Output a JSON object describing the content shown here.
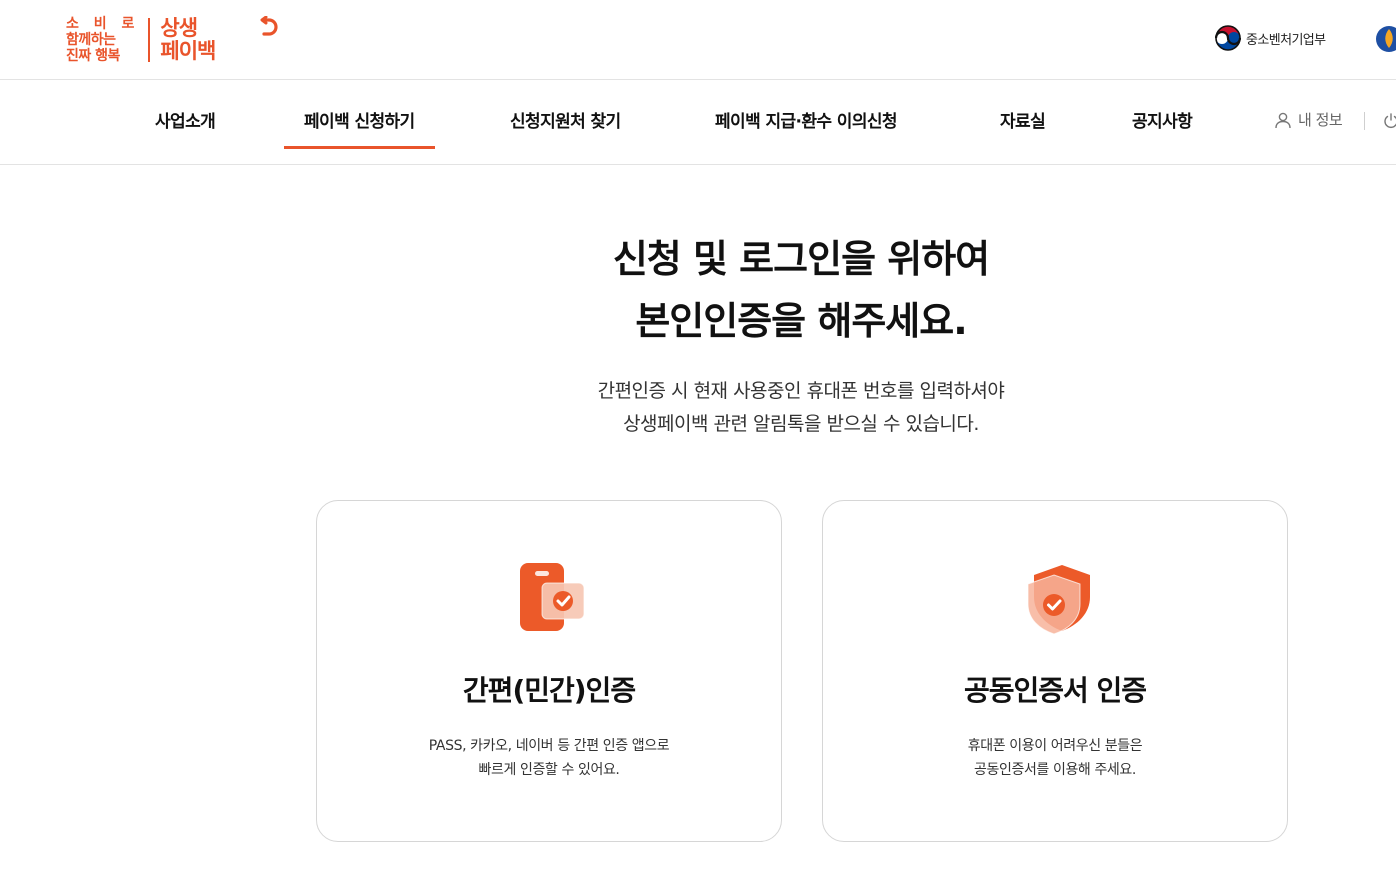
{
  "header": {
    "logo": {
      "slogan": [
        "소 비 로",
        "함께하는",
        "진짜 행복"
      ],
      "brand": [
        "상생",
        "페이백"
      ]
    },
    "ministry_label": "중소벤처기업부"
  },
  "nav": {
    "items": [
      {
        "label": "사업소개"
      },
      {
        "label": "페이백 신청하기",
        "active": true
      },
      {
        "label": "신청지원처 찾기"
      },
      {
        "label": "페이백 지급·환수 이의신청"
      },
      {
        "label": "자료실"
      },
      {
        "label": "공지사항"
      }
    ],
    "user_label": "내 정보"
  },
  "hero": {
    "title": [
      "신청 및 로그인을 위하여",
      "본인인증을 해주세요."
    ],
    "description": [
      "간편인증 시 현재 사용중인 휴대폰 번호를 입력하셔야",
      "상생페이백 관련 알림톡을 받으실 수 있습니다."
    ]
  },
  "cards": [
    {
      "icon": "phone-check-icon",
      "title": "간편(민간)인증",
      "description": [
        "PASS, 카카오, 네이버 등 간편 인증 앱으로",
        "빠르게 인증할 수 있어요."
      ]
    },
    {
      "icon": "shield-check-icon",
      "title": "공동인증서 인증",
      "description": [
        "휴대폰 이용이 어려우신 분들은",
        "공동인증서를 이용해 주세요."
      ]
    }
  ],
  "colors": {
    "accent": "#e9542b",
    "border": "#d6d6d6",
    "text": "#111111"
  }
}
